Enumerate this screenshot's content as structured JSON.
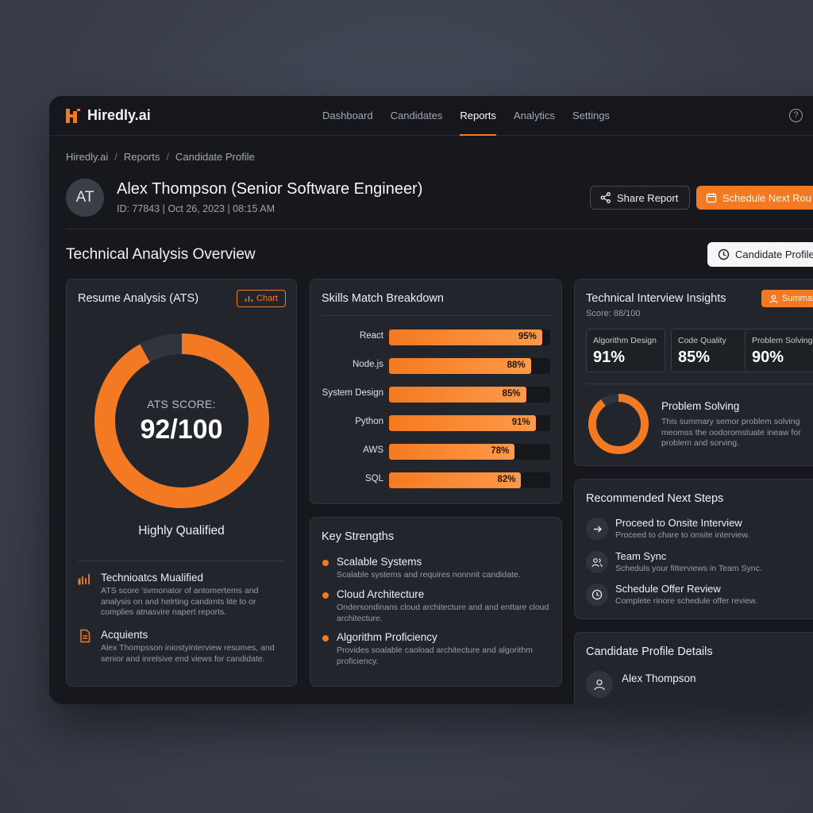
{
  "app": {
    "name": "Hiredly.ai",
    "accent": "#f37a23"
  },
  "nav": [
    {
      "label": "Dashboard"
    },
    {
      "label": "Candidates"
    },
    {
      "label": "Reports"
    },
    {
      "label": "Analytics"
    },
    {
      "label": "Settings"
    }
  ],
  "nav_active": "Reports",
  "help_icon": "?",
  "breadcrumb": [
    "Hiredly.ai",
    "Reports",
    "Candidate Profile"
  ],
  "candidate": {
    "initials": "AT",
    "title": "Alex Thompson (Senior Software Engineer)",
    "meta": "ID: 77843 | Oct 26, 2023 | 08:15 AM"
  },
  "actions": {
    "share": "Share Report",
    "schedule": "Schedule Next Rou"
  },
  "section": {
    "title": "Technical Analysis Overview",
    "profile_button": "Candidate Profile"
  },
  "resume": {
    "title": "Resume Analysis (ATS)",
    "chart_button": "Chart",
    "score_label": "ATS SCORE:",
    "score": "92/100",
    "score_fraction": 0.92,
    "verdict": "Highly Qualified",
    "items": [
      {
        "icon": "bar-chart-icon",
        "title": "Technioatcs Mualified",
        "desc": "ATS score 'svmonator of antomertems and analysis on and helrting candimts lite to or complies atnasvire napert reports."
      },
      {
        "icon": "document-icon",
        "title": "Acquients",
        "desc": "Alex Thompsson iniostyinterview resumes, and senior and inrelsive end views for candidate."
      }
    ]
  },
  "skills": {
    "title": "Skills Match Breakdown",
    "items": [
      {
        "label": "React",
        "value": 95,
        "text": "95%"
      },
      {
        "label": "Node.js",
        "value": 88,
        "text": "88%"
      },
      {
        "label": "System Design",
        "value": 85,
        "text": "85%"
      },
      {
        "label": "Python",
        "value": 91,
        "text": "91%"
      },
      {
        "label": "AWS",
        "value": 78,
        "text": "78%"
      },
      {
        "label": "SQL",
        "value": 82,
        "text": "82%"
      }
    ]
  },
  "strengths": {
    "title": "Key Strengths",
    "items": [
      {
        "title": "Scalable Systems",
        "desc": "Scalable systems and requires nonnnit candidate."
      },
      {
        "title": "Cloud Architecture",
        "desc": "Ondersondinans cloud architecture and and enttare cloud architecture."
      },
      {
        "title": "Algorithm Proficiency",
        "desc": "Provides soalable caoload architecture and algorithm proficiency."
      }
    ]
  },
  "insights": {
    "title": "Technical Interview Insights",
    "summary_button": "Summary",
    "score": "Score: 88/100",
    "metrics": [
      {
        "label": "Algorithm Design",
        "value": "91%"
      },
      {
        "label": "Code Quality",
        "value": "85%"
      },
      {
        "label": "Problem Solving",
        "value": "90%"
      }
    ],
    "focus": {
      "title": "Problem Solving",
      "desc": "This summary semor problem solving meomss the oodoromstuate ineaw for problem and sorving.",
      "fraction": 0.9
    }
  },
  "next_steps": {
    "title": "Recommended Next Steps",
    "items": [
      {
        "icon": "arrow-right-icon",
        "title": "Proceed to Onsite Interview",
        "desc": "Proceed to chare to onsite interview."
      },
      {
        "icon": "users-icon",
        "title": "Team Sync",
        "desc": "Scheduls your fitterviews in Team Sync."
      },
      {
        "icon": "clock-icon",
        "title": "Schedule Offer Review",
        "desc": "Complete rinore schedule offer review."
      }
    ]
  },
  "profile_details": {
    "title": "Candidate Profile Details",
    "name": "Alex Thompson"
  }
}
